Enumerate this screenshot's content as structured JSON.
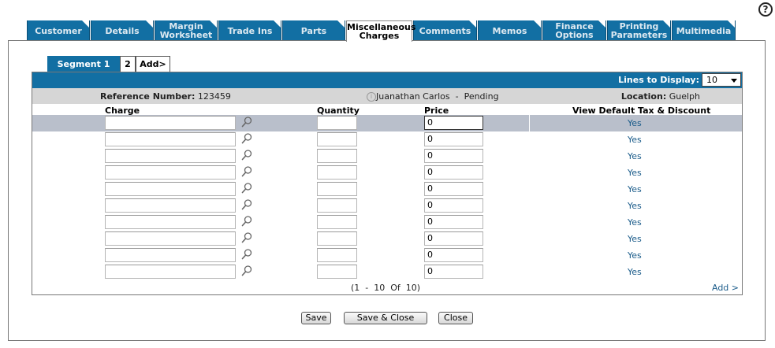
{
  "tabs": [
    {
      "label": "Customer"
    },
    {
      "label": "Details"
    },
    {
      "label": "Margin Worksheet"
    },
    {
      "label": "Trade Ins"
    },
    {
      "label": "Parts"
    },
    {
      "label": "Miscellaneous Charges"
    },
    {
      "label": "Comments"
    },
    {
      "label": "Memos"
    },
    {
      "label": "Finance Options"
    },
    {
      "label": "Printing Parameters"
    },
    {
      "label": "Multimedia"
    }
  ],
  "active_tab": "Miscellaneous Charges",
  "segments": [
    {
      "label": "Segment 1"
    },
    {
      "label": "2"
    },
    {
      "label": "Add>"
    }
  ],
  "lines_to_display": {
    "label": "Lines to Display:",
    "value": "10"
  },
  "info": {
    "ref_label": "Reference Number:",
    "ref_value": "123459",
    "customer": "Juanathan Carlos  -  Pending",
    "loc_label": "Location:",
    "loc_value": "Guelph"
  },
  "columns": {
    "charge": "Charge",
    "quantity": "Quantity",
    "price": "Price",
    "tax": "View Default Tax & Discount"
  },
  "rows": [
    {
      "charge": "",
      "quantity": "",
      "price": "0",
      "tax": "Yes"
    },
    {
      "charge": "",
      "quantity": "",
      "price": "0",
      "tax": "Yes"
    },
    {
      "charge": "",
      "quantity": "",
      "price": "0",
      "tax": "Yes"
    },
    {
      "charge": "",
      "quantity": "",
      "price": "0",
      "tax": "Yes"
    },
    {
      "charge": "",
      "quantity": "",
      "price": "0",
      "tax": "Yes"
    },
    {
      "charge": "",
      "quantity": "",
      "price": "0",
      "tax": "Yes"
    },
    {
      "charge": "",
      "quantity": "",
      "price": "0",
      "tax": "Yes"
    },
    {
      "charge": "",
      "quantity": "",
      "price": "0",
      "tax": "Yes"
    },
    {
      "charge": "",
      "quantity": "",
      "price": "0",
      "tax": "Yes"
    },
    {
      "charge": "",
      "quantity": "",
      "price": "0",
      "tax": "Yes"
    }
  ],
  "pager": "(1  -  10  Of  10)",
  "add_link": "Add >",
  "buttons": {
    "save": "Save",
    "save_close": "Save & Close",
    "close": "Close"
  },
  "help_glyph": "?",
  "icons": {
    "help": "question-circle-icon",
    "lookup": "magnifier-icon",
    "info": "info-icon"
  },
  "colors": {
    "tab_blue": "#126fa3",
    "selected_row": "#b9bfcb",
    "link": "#1a5b8a"
  }
}
